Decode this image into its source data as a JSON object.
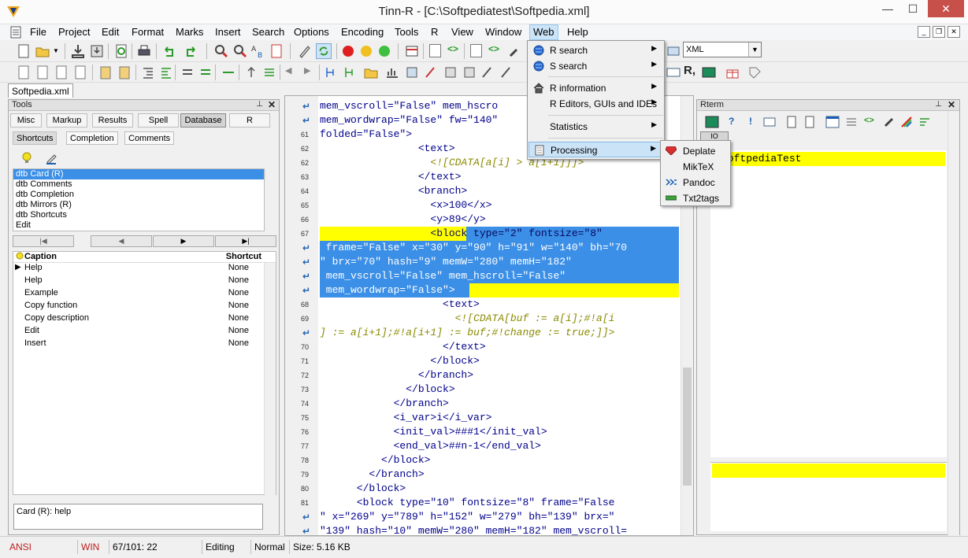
{
  "window": {
    "title": "Tinn-R - [C:\\Softpediatest\\Softpedia.xml]",
    "minimize": "—",
    "maximize": "☐",
    "close": "✕"
  },
  "menubar": [
    "File",
    "Project",
    "Edit",
    "Format",
    "Marks",
    "Insert",
    "Search",
    "Options",
    "Encoding",
    "Tools",
    "R",
    "View",
    "Window",
    "Web",
    "Help"
  ],
  "toolbar": {
    "syntax_combo": "XML"
  },
  "document_tab": "Softpedia.xml",
  "tools_panel": {
    "title": "Tools",
    "tabs": [
      "Misc",
      "Markup",
      "Results",
      "Spell",
      "Database",
      "R"
    ],
    "subtabs": [
      "Shortcuts",
      "Completion",
      "Comments"
    ],
    "db_list": [
      "dtb Card (R)",
      "dtb Comments",
      "dtb Completion",
      "dtb Mirrors (R)",
      "dtb Shortcuts",
      "Edit"
    ],
    "grid_header": {
      "caption": "Caption",
      "shortcut": "Shortcut"
    },
    "grid_rows": [
      {
        "caption": "Help",
        "shortcut": "None"
      },
      {
        "caption": "Help",
        "shortcut": "None"
      },
      {
        "caption": "Example",
        "shortcut": "None"
      },
      {
        "caption": "Copy function",
        "shortcut": "None"
      },
      {
        "caption": "Copy description",
        "shortcut": "None"
      },
      {
        "caption": "Edit",
        "shortcut": "None"
      },
      {
        "caption": "Insert",
        "shortcut": "None"
      }
    ],
    "status_text": "Card (R): help"
  },
  "editor_lines": [
    {
      "n": "",
      "text": "mem_vscroll=\"False\" mem_hscro"
    },
    {
      "n": "",
      "text": "mem_wordwrap=\"False\" fw=\"140\""
    },
    {
      "n": "61",
      "text": "folded=\"False\">"
    },
    {
      "n": "62",
      "text": "                <text>"
    },
    {
      "n": "62",
      "text": "                  <![CDATA[a[i] > a[i+1]]]>"
    },
    {
      "n": "63",
      "text": "                </text>"
    },
    {
      "n": "64",
      "text": "                <branch>"
    },
    {
      "n": "65",
      "text": "                  <x>100</x>"
    },
    {
      "n": "66",
      "text": "                  <y>89</y>"
    },
    {
      "n": "67",
      "text": "                  <block type=\"2\" fontsize=\"8\""
    },
    {
      "n": "",
      "text": " frame=\"False\" x=\"30\" y=\"90\" h=\"91\" w=\"140\" bh=\"70"
    },
    {
      "n": "",
      "text": "\" brx=\"70\" hash=\"9\" memW=\"280\" memH=\"182\""
    },
    {
      "n": "",
      "text": " mem_vscroll=\"False\" mem_hscroll=\"False\""
    },
    {
      "n": "",
      "text": " mem_wordwrap=\"False\">"
    },
    {
      "n": "68",
      "text": "                    <text>"
    },
    {
      "n": "69",
      "text": "                      <![CDATA[buf := a[i];#!a[i"
    },
    {
      "n": "",
      "text": "] := a[i+1];#!a[i+1] := buf;#!change := true;]]>"
    },
    {
      "n": "70",
      "text": "                    </text>"
    },
    {
      "n": "71",
      "text": "                  </block>"
    },
    {
      "n": "72",
      "text": "                </branch>"
    },
    {
      "n": "73",
      "text": "              </block>"
    },
    {
      "n": "74",
      "text": "            </branch>"
    },
    {
      "n": "75",
      "text": "            <i_var>i</i_var>"
    },
    {
      "n": "76",
      "text": "            <init_val>###1</init_val>"
    },
    {
      "n": "77",
      "text": "            <end_val>##n-1</end_val>"
    },
    {
      "n": "78",
      "text": "          </block>"
    },
    {
      "n": "79",
      "text": "        </branch>"
    },
    {
      "n": "80",
      "text": "      </block>"
    },
    {
      "n": "81",
      "text": "      <block type=\"10\" fontsize=\"8\" frame=\"False"
    },
    {
      "n": "",
      "text": "\" x=\"269\" y=\"789\" h=\"152\" w=\"279\" bh=\"139\" brx=\""
    },
    {
      "n": "",
      "text": "\"139\" hash=\"10\" memW=\"280\" memH=\"182\" mem_vscroll="
    }
  ],
  "rterm": {
    "title": "Rterm",
    "tab": "IO",
    "output": "SoftpediaTest"
  },
  "web_menu": {
    "items": [
      {
        "label": "R search",
        "arrow": "▶"
      },
      {
        "label": "S search",
        "arrow": "▶"
      },
      {
        "label": "R information",
        "arrow": "▶"
      },
      {
        "label": "R Editors, GUIs and IDEs",
        "arrow": "▶"
      },
      {
        "label": "Statistics",
        "arrow": "▶"
      },
      {
        "label": "Processing",
        "arrow": "▶"
      }
    ]
  },
  "processing_menu": [
    "Deplate",
    "MikTeX",
    "Pandoc",
    "Txt2tags"
  ],
  "statusbar": [
    "ANSI",
    "WIN",
    "67/101: 22",
    "Editing",
    "Normal",
    "Size: 5.16 KB"
  ],
  "colors": {
    "accent": "#3b8fe6",
    "highlight": "#ffff00",
    "close_button": "#c7504b"
  }
}
